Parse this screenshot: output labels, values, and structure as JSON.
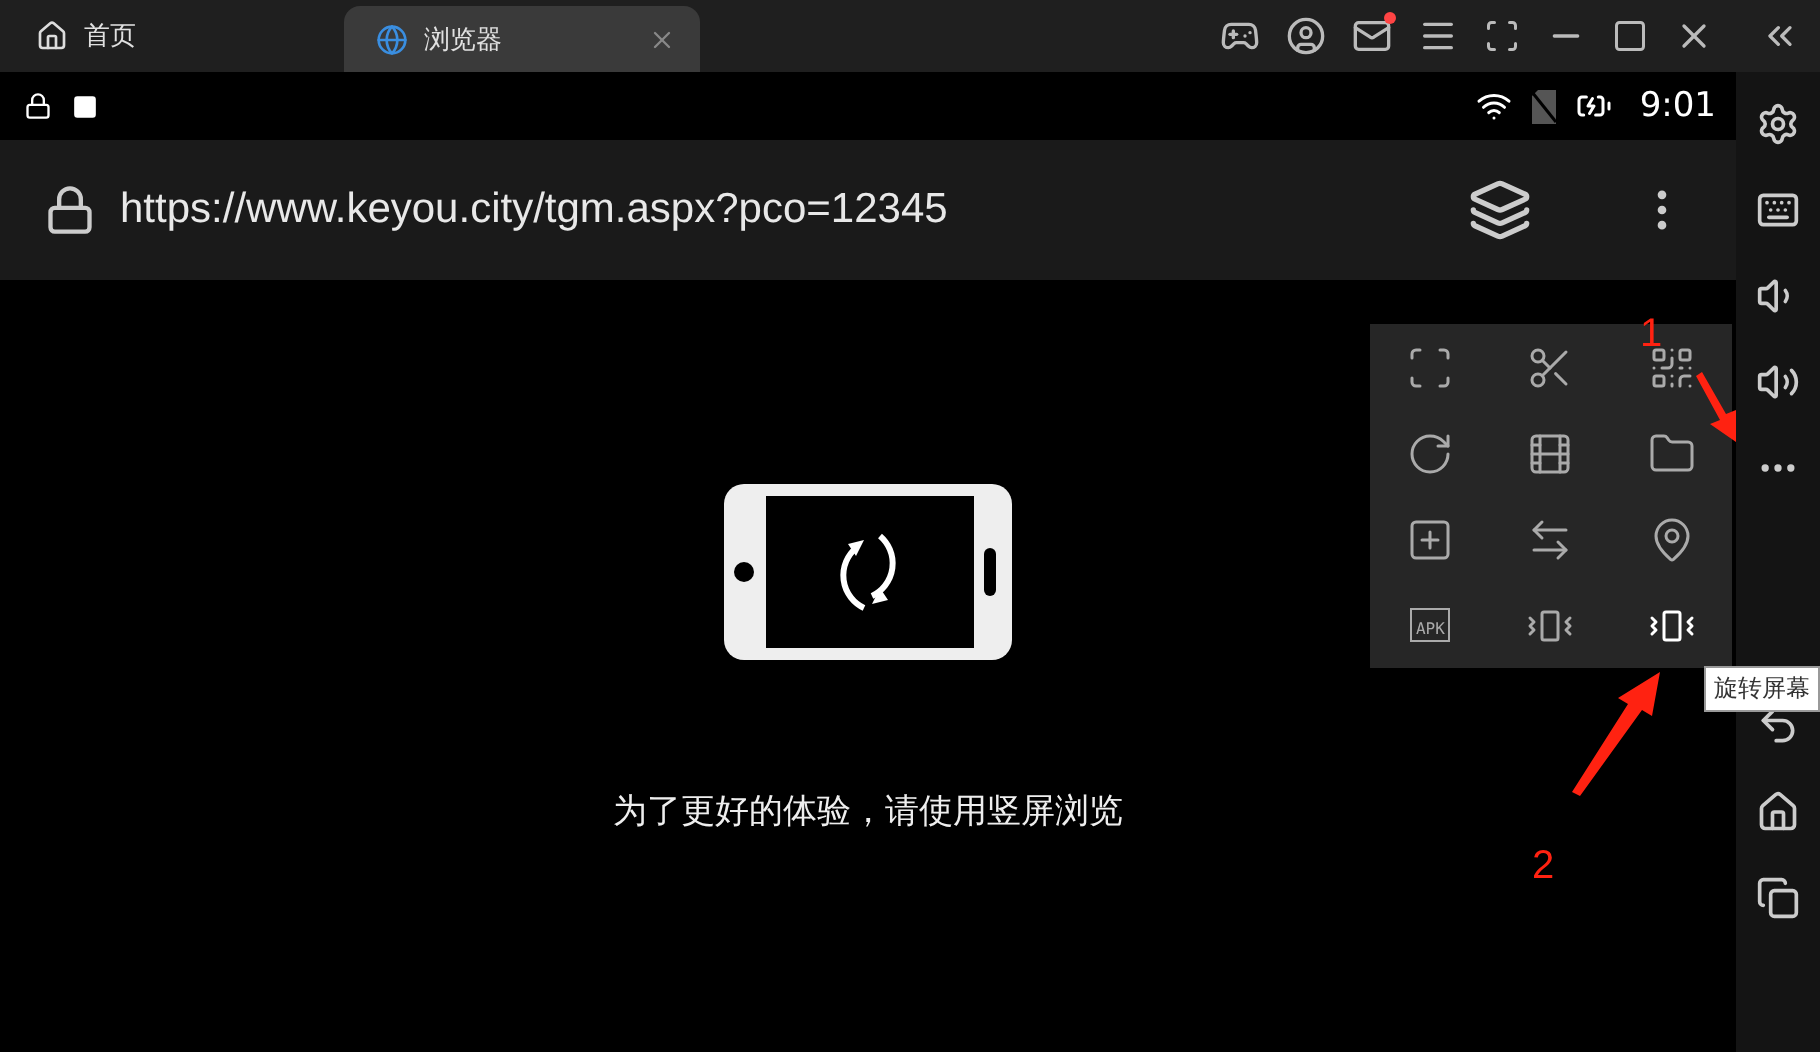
{
  "tabs": [
    {
      "label": "首页",
      "kind": "home",
      "selected": false
    },
    {
      "label": "浏览器",
      "kind": "browser",
      "selected": true
    }
  ],
  "window_controls": {
    "mail_unread": true
  },
  "status_bar": {
    "time": "9:01"
  },
  "address_bar": {
    "url": "https://www.keyou.city/tgm.aspx?pco=12345"
  },
  "content": {
    "message": "为了更好的体验，请使用竖屏浏览"
  },
  "tool_menu": {
    "items": [
      {
        "kind": "screenshot"
      },
      {
        "kind": "scissors"
      },
      {
        "kind": "qrcode"
      },
      {
        "kind": "record"
      },
      {
        "kind": "video"
      },
      {
        "kind": "folder"
      },
      {
        "kind": "add-window"
      },
      {
        "kind": "sync"
      },
      {
        "kind": "location"
      },
      {
        "kind": "apk",
        "text": "APK"
      },
      {
        "kind": "shake"
      },
      {
        "kind": "rotate"
      }
    ]
  },
  "tooltip": "旋转屏幕",
  "sidebar": [
    {
      "kind": "settings"
    },
    {
      "kind": "keyboard"
    },
    {
      "kind": "volume-down"
    },
    {
      "kind": "volume-up"
    },
    {
      "kind": "more"
    },
    {
      "kind": "back"
    },
    {
      "kind": "home"
    },
    {
      "kind": "recent"
    }
  ],
  "annotations": [
    "1",
    "2"
  ]
}
